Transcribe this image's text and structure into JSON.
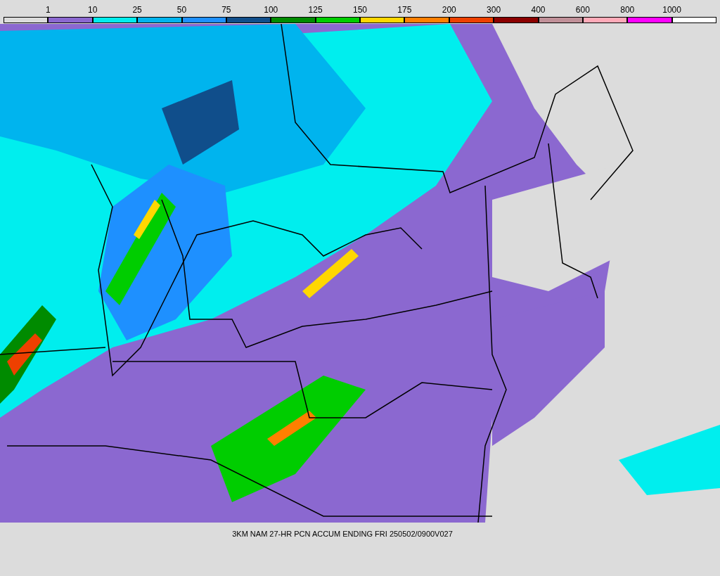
{
  "legend": {
    "bins": [
      {
        "color": "#dcdcdc",
        "label": "1"
      },
      {
        "color": "#8b68d0",
        "label": "10"
      },
      {
        "color": "#00eeee",
        "label": "25"
      },
      {
        "color": "#00b4ee",
        "label": "50"
      },
      {
        "color": "#1e90ff",
        "label": "75"
      },
      {
        "color": "#104e8b",
        "label": "100"
      },
      {
        "color": "#008b00",
        "label": "125"
      },
      {
        "color": "#00cd00",
        "label": "150"
      },
      {
        "color": "#ffd700",
        "label": "175"
      },
      {
        "color": "#ff7f00",
        "label": "200"
      },
      {
        "color": "#ee4000",
        "label": "300"
      },
      {
        "color": "#8b0000",
        "label": "400"
      },
      {
        "color": "#c09098",
        "label": "600"
      },
      {
        "color": "#ffaab8",
        "label": "800"
      },
      {
        "color": "#ff00ff",
        "label": "1000"
      },
      {
        "color": "#ffffff"
      }
    ]
  },
  "caption": "3KM NAM 27-HR PCN ACCUM ENDING FRI 250502/0900V027"
}
